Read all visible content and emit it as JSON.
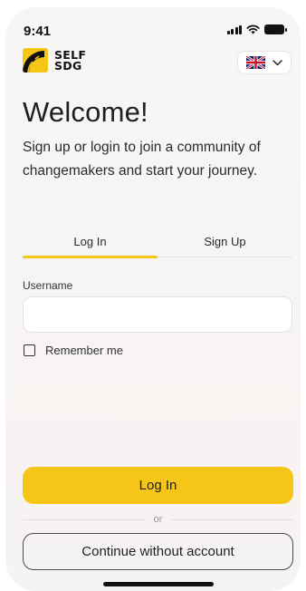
{
  "status_bar": {
    "time": "9:41"
  },
  "brand": {
    "line1": "SELF",
    "line2": "SDG",
    "accent_color": "#f5c518"
  },
  "language_selector": {
    "flag_icon": "uk-flag-icon",
    "chevron_icon": "chevron-down-icon"
  },
  "welcome": {
    "title": "Welcome!",
    "subtitle": "Sign up or login to join a community of changemakers and start your journey."
  },
  "tabs": [
    {
      "label": "Log In",
      "active": true
    },
    {
      "label": "Sign Up",
      "active": false
    }
  ],
  "form": {
    "username_label": "Username",
    "username_value": "",
    "remember_label": "Remember me",
    "remember_checked": false
  },
  "actions": {
    "login_label": "Log In",
    "divider_text": "or",
    "guest_label": "Continue without account"
  },
  "colors": {
    "primary": "#f5c518",
    "background": "#f7f6f5",
    "text": "#1f1f1f"
  }
}
